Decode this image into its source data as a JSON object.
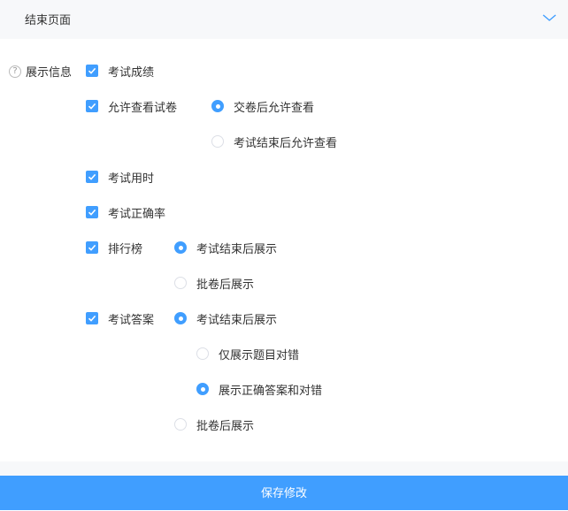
{
  "section": {
    "title": "结束页面",
    "collapse_icon": "chevron-down-icon"
  },
  "display_info": {
    "label": "展示信息",
    "help_icon": "question-circle-icon",
    "help_glyph": "?"
  },
  "options": {
    "exam_score": {
      "label": "考试成绩",
      "checked": true
    },
    "allow_view_paper": {
      "label": "允许查看试卷",
      "checked": true,
      "choices": [
        {
          "label": "交卷后允许查看",
          "selected": true
        },
        {
          "label": "考试结束后允许查看",
          "selected": false
        }
      ]
    },
    "exam_time": {
      "label": "考试用时",
      "checked": true
    },
    "accuracy": {
      "label": "考试正确率",
      "checked": true
    },
    "leaderboard": {
      "label": "排行榜",
      "checked": true,
      "choices": [
        {
          "label": "考试结束后展示",
          "selected": true
        },
        {
          "label": "批卷后展示",
          "selected": false
        }
      ]
    },
    "answers": {
      "label": "考试答案",
      "checked": true,
      "choices": [
        {
          "label": "考试结束后展示",
          "selected": true
        },
        {
          "label": "批卷后展示",
          "selected": false
        }
      ],
      "sub_choices": [
        {
          "label": "仅展示题目对错",
          "selected": false
        },
        {
          "label": "展示正确答案和对错",
          "selected": true
        }
      ]
    }
  },
  "footer": {
    "save_label": "保存修改"
  },
  "colors": {
    "accent": "#409eff",
    "header_bg": "#f7f8fa",
    "text": "#333333"
  }
}
